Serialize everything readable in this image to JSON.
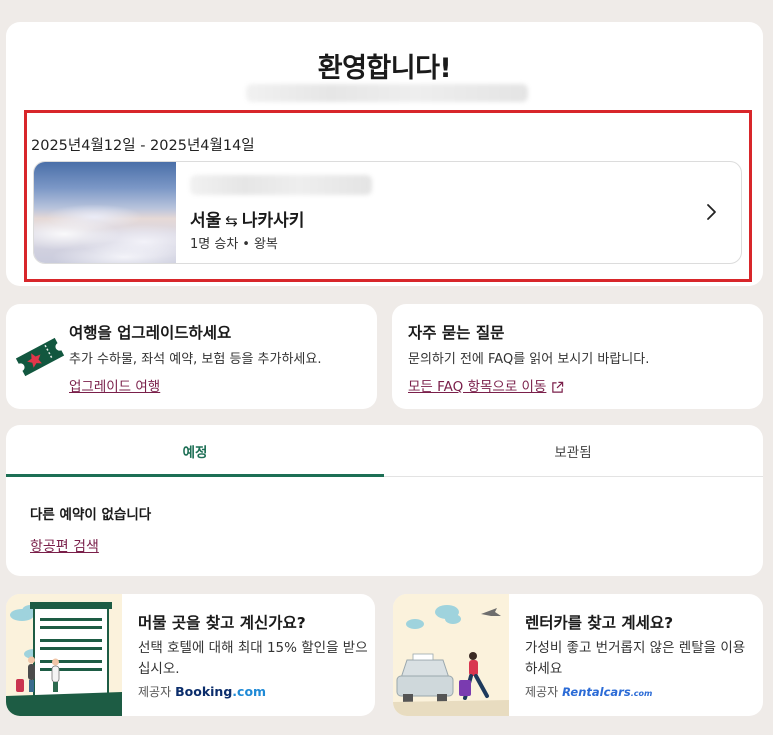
{
  "welcome": {
    "title": "환영합니다!",
    "trip": {
      "dates": "2025년4월12일 - 2025년4월14일",
      "origin": "서울",
      "swap_symbol": "⇆",
      "destination": "나카사키",
      "passengers": "1명 승차",
      "separator": "•",
      "trip_type": "왕복"
    }
  },
  "upgrade": {
    "title": "여행을 업그레이드하세요",
    "description": "추가 수하물, 좌석 예약, 보험 등을 추가하세요.",
    "link": "업그레이드 여행"
  },
  "faq": {
    "title": "자주 묻는 질문",
    "description": "문의하기 전에 FAQ를 읽어 보시기 바랍니다.",
    "link": "모든 FAQ 항목으로 이동"
  },
  "trips": {
    "tabs": [
      "예정",
      "보관됨"
    ],
    "active_tab": "예정",
    "empty_message": "다른 예약이 없습니다",
    "search_link": "항공편 검색"
  },
  "hotel_promo": {
    "title": "머물 곳을 찾고 계신가요?",
    "description": "선택 호텔에 대해 최대 15% 할인을 받으십시오.",
    "provider_label": "제공자",
    "brand_main": "Booking",
    "brand_suffix": ".com"
  },
  "rental_promo": {
    "title": "렌터카를 찾고 계세요?",
    "description": "가성비 좋고 번거롭지 않은 렌탈을 이용하세요",
    "provider_label": "제공자",
    "brand_main": "Rentalcars",
    "brand_suffix": ".com"
  },
  "colors": {
    "accent_green": "#1d6f55",
    "link_maroon": "#7a1f4a",
    "highlight_red": "#d8262a",
    "background": "#efebe8"
  },
  "icons": {
    "trip_chevron": "chevron-right-icon",
    "upgrade": "ticket-icon",
    "faq_link": "external-link-icon"
  }
}
